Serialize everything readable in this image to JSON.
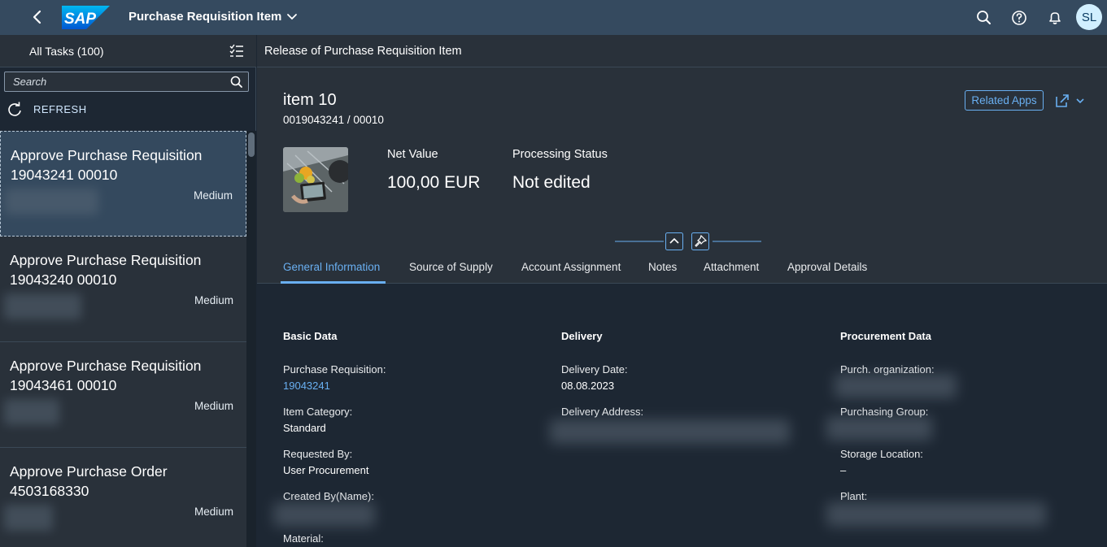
{
  "shell": {
    "logo_text": "SAP",
    "app_title": "Purchase Requisition Item",
    "user_initials": "SL",
    "accent_color": "#69aff1",
    "icons": [
      "back-icon",
      "search-icon",
      "help-icon",
      "notifications-icon"
    ]
  },
  "master": {
    "title": "All Tasks (100)",
    "search_placeholder": "Search",
    "refresh_label": "REFRESH",
    "items": [
      {
        "title": "Approve Purchase Requisition 19043241 00010",
        "priority": "Medium"
      },
      {
        "title": "Approve Purchase Requisition 19043240 00010",
        "priority": "Medium"
      },
      {
        "title": "Approve Purchase Requisition 19043461 00010",
        "priority": "Medium"
      },
      {
        "title": "Approve Purchase Order 4503168330",
        "priority": "Medium"
      }
    ]
  },
  "detail": {
    "page_title": "Release of Purchase Requisition Item",
    "object_title": "item 10",
    "object_subtitle": "0019043241 / 00010",
    "related_apps_label": "Related Apps",
    "net_value_label": "Net Value",
    "net_value": "100,00  EUR",
    "status_label": "Processing Status",
    "status_value": "Not edited",
    "tabs": [
      "General Information",
      "Source of Supply",
      "Account Assignment",
      "Notes",
      "Attachment",
      "Approval Details"
    ],
    "basic": {
      "title": "Basic Data",
      "pr_label": "Purchase Requisition:",
      "pr_value": "19043241",
      "item_cat_label": "Item Category:",
      "item_cat_value": "Standard",
      "requested_label": "Requested By:",
      "requested_value": "User Procurement",
      "created_label": "Created By(Name):",
      "material_label": "Material:"
    },
    "delivery": {
      "title": "Delivery",
      "date_label": "Delivery Date:",
      "date_value": "08.08.2023",
      "address_label": "Delivery Address:"
    },
    "procurement": {
      "title": "Procurement Data",
      "org_label": "Purch. organization:",
      "group_label": "Purchasing Group:",
      "storage_label": "Storage Location:",
      "storage_value": "–",
      "plant_label": "Plant:"
    }
  }
}
